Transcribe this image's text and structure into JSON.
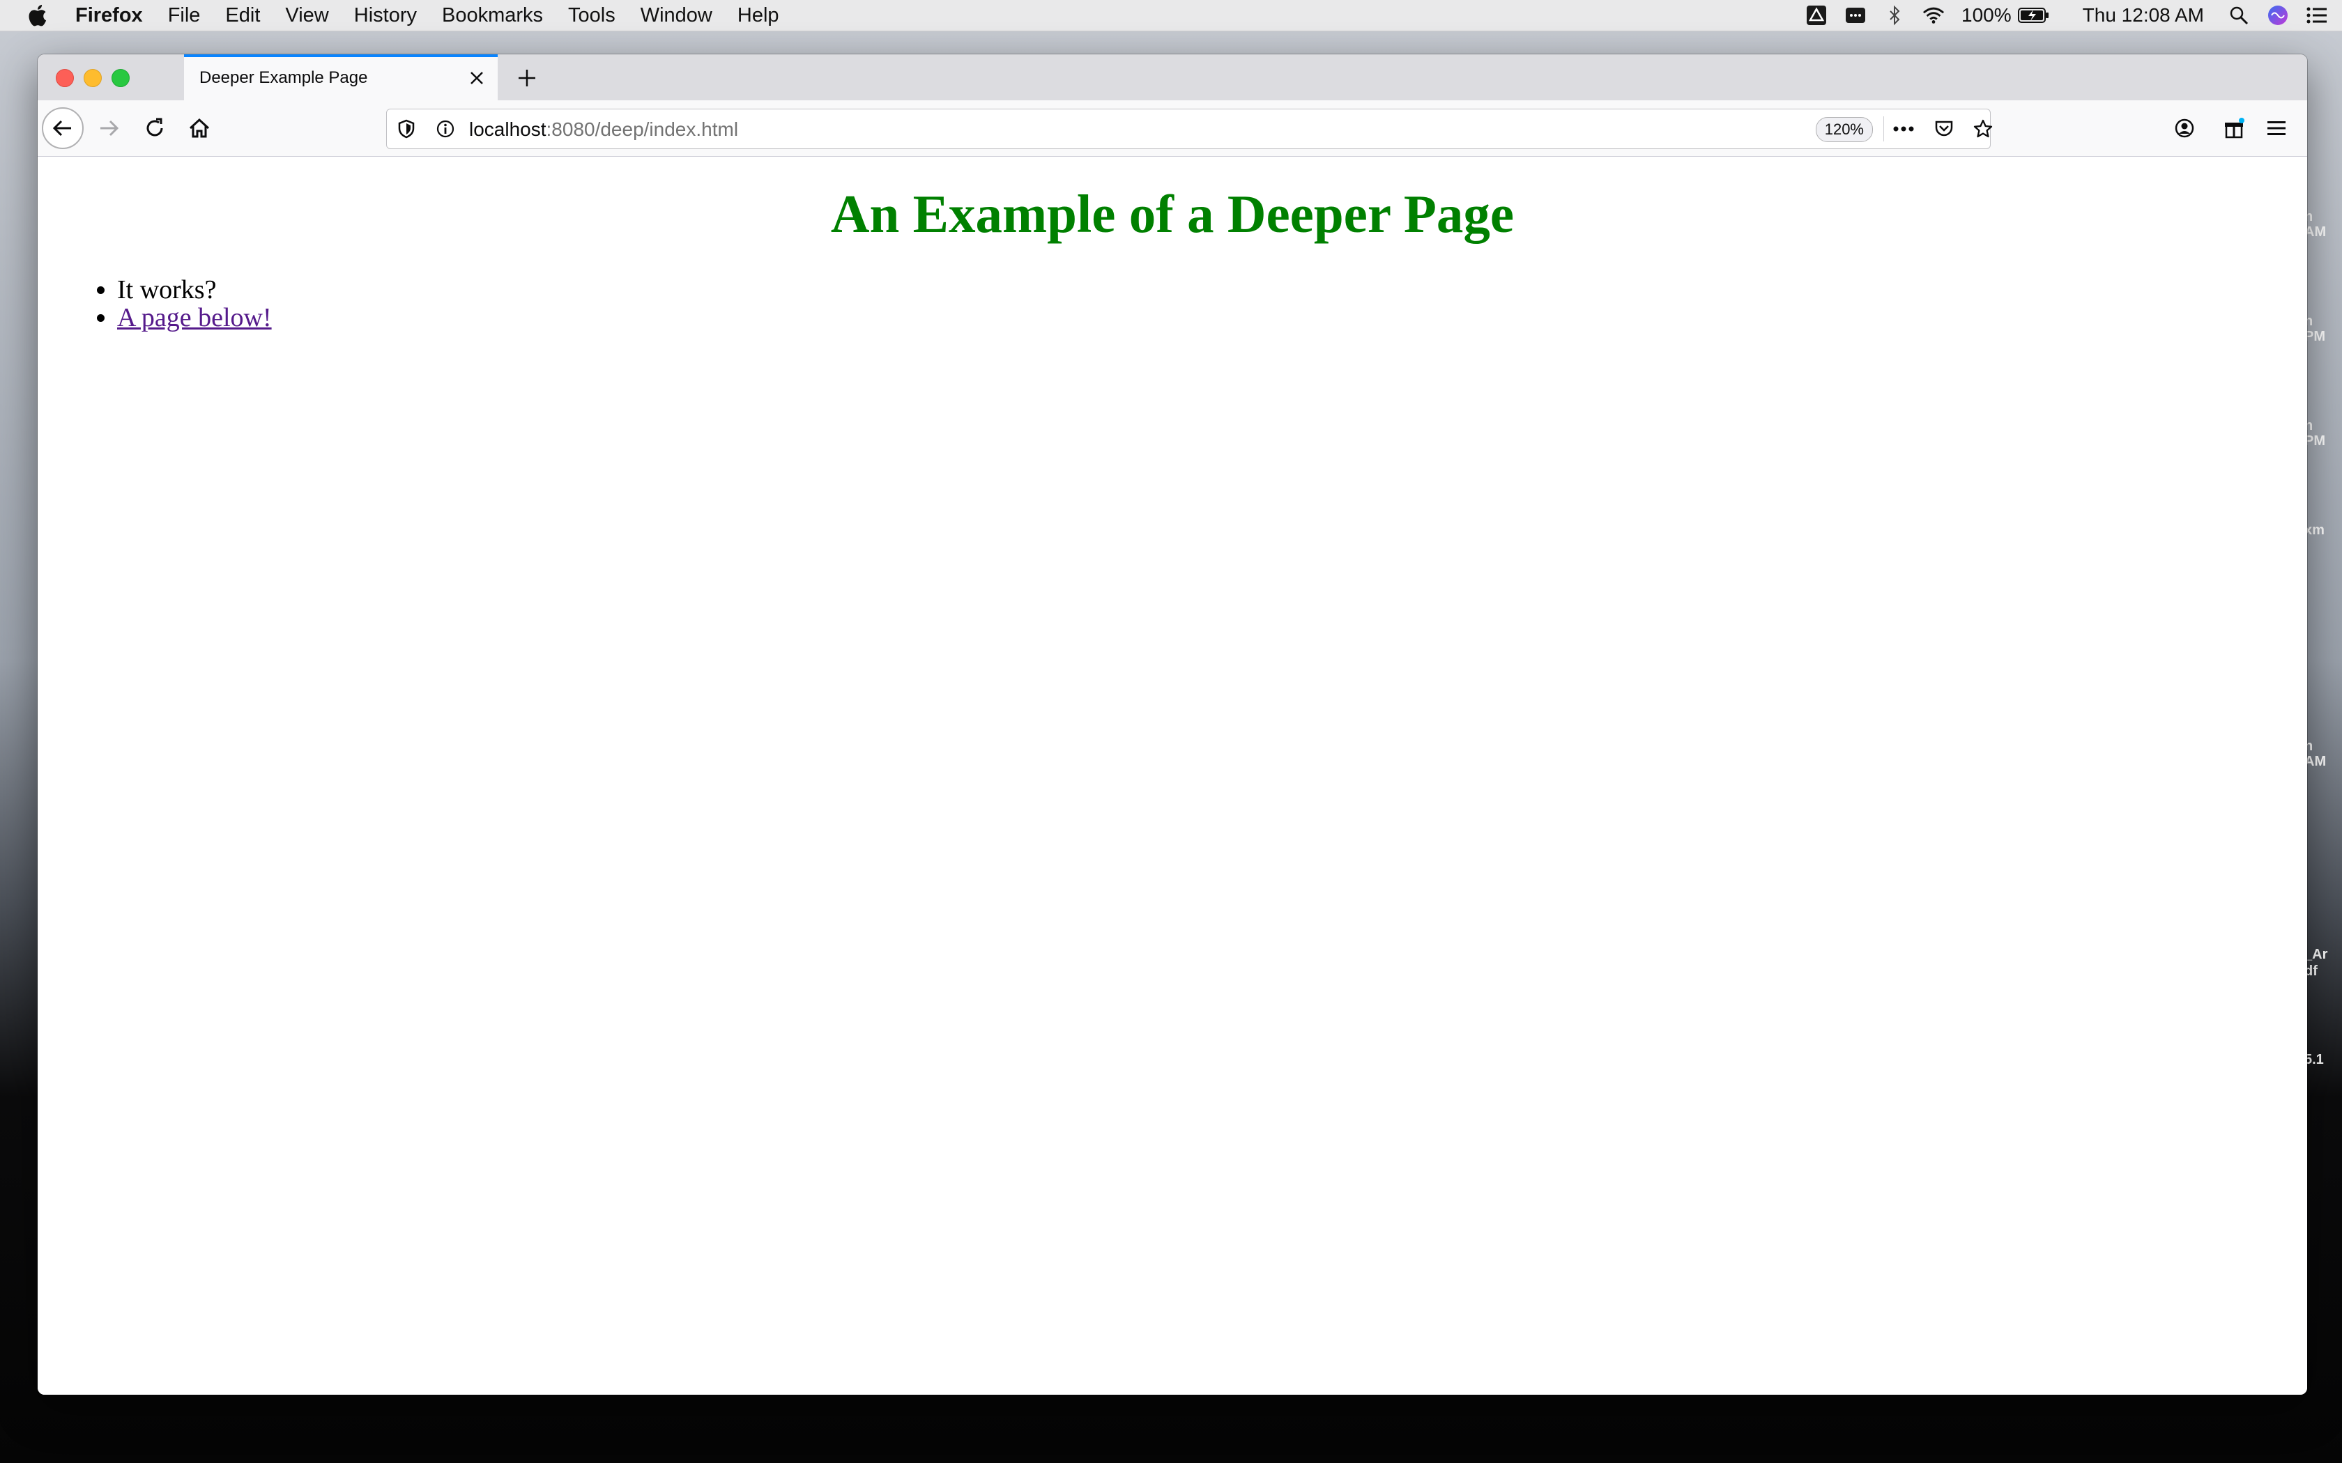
{
  "menubar": {
    "app_name": "Firefox",
    "menus": [
      "File",
      "Edit",
      "View",
      "History",
      "Bookmarks",
      "Tools",
      "Window",
      "Help"
    ],
    "battery_text": "100%",
    "clock": "Thu 12:08 AM"
  },
  "browser": {
    "tab": {
      "title": "Deeper Example Page"
    },
    "address_bar": {
      "host": "localhost",
      "path": ":8080/deep/index.html",
      "zoom": "120%"
    }
  },
  "page": {
    "heading": "An Example of a Deeper Page",
    "items": [
      {
        "text": "It works?"
      },
      {
        "text": "A page below!"
      }
    ],
    "heading_color": "#008000",
    "link_color": "#551a8b"
  },
  "desktop_fragments": [
    "n\nAM",
    "n\nPM",
    "n\nPM",
    "xm",
    "n\nAM",
    "_Ar\ndf",
    "5.1"
  ]
}
